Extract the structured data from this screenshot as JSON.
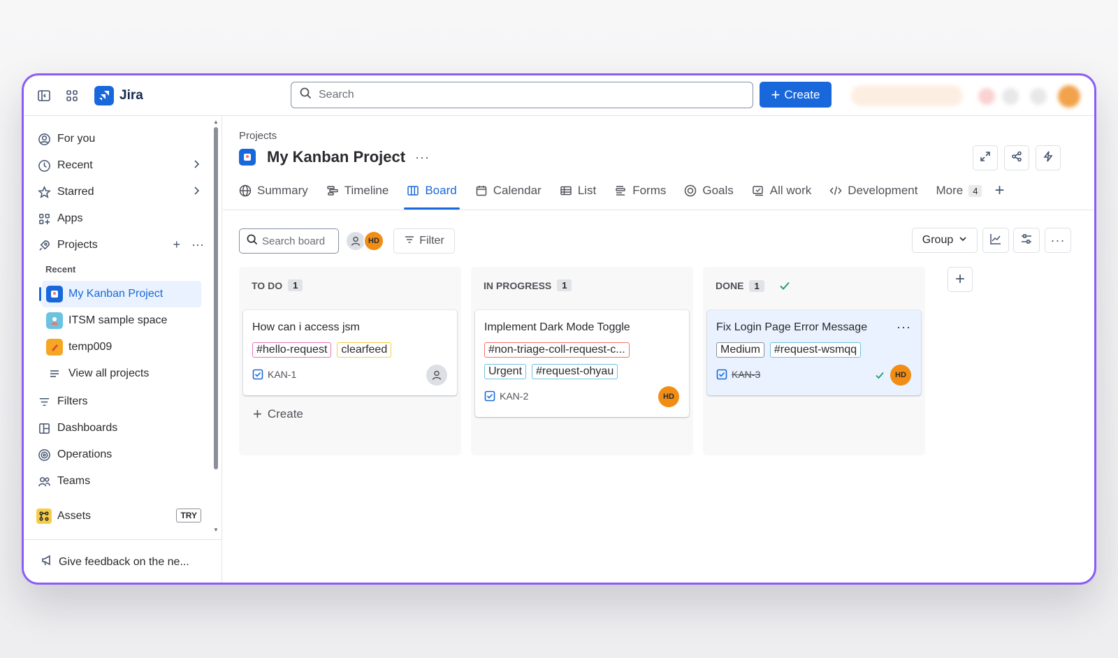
{
  "app": {
    "name": "Jira"
  },
  "topbar": {
    "search_placeholder": "Search",
    "create_label": "Create"
  },
  "sidebar": {
    "items": {
      "for_you": "For you",
      "recent": "Recent",
      "starred": "Starred",
      "apps": "Apps",
      "projects": "Projects",
      "filters": "Filters",
      "dashboards": "Dashboards",
      "operations": "Operations",
      "teams": "Teams",
      "assets": "Assets"
    },
    "recent_label": "Recent",
    "projects_list": [
      {
        "name": "My Kanban Project",
        "color": "#1868db"
      },
      {
        "name": "ITSM sample space",
        "color": "#6cc3e0"
      },
      {
        "name": "temp009",
        "color": "#f5a623"
      }
    ],
    "view_all": "View all projects",
    "try_badge": "TRY",
    "feedback": "Give feedback on the ne..."
  },
  "main": {
    "breadcrumb": "Projects",
    "title": "My Kanban Project",
    "tabs": [
      {
        "label": "Summary",
        "icon": "globe-icon"
      },
      {
        "label": "Timeline",
        "icon": "timeline-icon"
      },
      {
        "label": "Board",
        "icon": "board-icon"
      },
      {
        "label": "Calendar",
        "icon": "calendar-icon"
      },
      {
        "label": "List",
        "icon": "list-icon"
      },
      {
        "label": "Forms",
        "icon": "forms-icon"
      },
      {
        "label": "Goals",
        "icon": "goals-icon"
      },
      {
        "label": "All work",
        "icon": "all-work-icon"
      },
      {
        "label": "Development",
        "icon": "code-icon"
      }
    ],
    "more_label": "More",
    "more_count": "4",
    "board": {
      "search_placeholder": "Search board",
      "avatar_initials": "HD",
      "filter_label": "Filter",
      "group_label": "Group",
      "columns": [
        {
          "title": "TO DO",
          "count": "1",
          "create_label": "Create",
          "cards": [
            {
              "title": "How can i access jsm",
              "labels": [
                "#hello-request",
                "clearfeed"
              ],
              "key": "KAN-1",
              "assignee": ""
            }
          ]
        },
        {
          "title": "IN PROGRESS",
          "count": "1",
          "cards": [
            {
              "title": "Implement Dark Mode Toggle",
              "labels": [
                "#non-triage-coll-request-c...",
                "Urgent",
                "#request-ohyau"
              ],
              "key": "KAN-2",
              "assignee": "HD"
            }
          ]
        },
        {
          "title": "DONE",
          "count": "1",
          "cards": [
            {
              "title": "Fix Login Page Error Message",
              "labels": [
                "Medium",
                "#request-wsmqq"
              ],
              "key": "KAN-3",
              "assignee": "HD"
            }
          ]
        }
      ]
    }
  },
  "colors": {
    "accent": "#1868db",
    "window_border": "#8b5cf6",
    "done_green": "#22a06b",
    "avatar_orange": "#f18d13"
  }
}
